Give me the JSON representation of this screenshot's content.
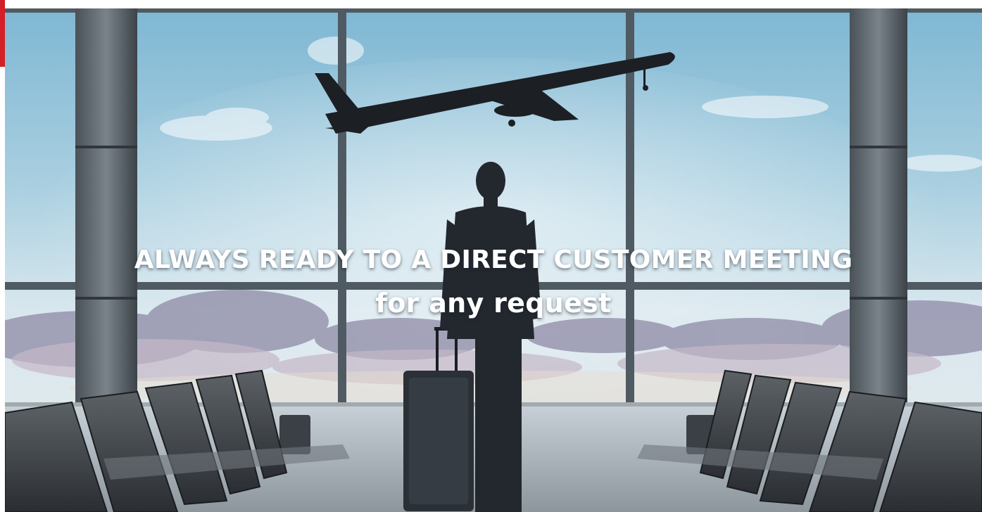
{
  "brand": {
    "accent_color": "#d31f26"
  },
  "hero": {
    "headline": "ALWAYS READY TO A DIRECT CUSTOMER MEETING",
    "subheadline": "for any request",
    "scene": "airport-terminal-businessman-watching-airplane"
  }
}
